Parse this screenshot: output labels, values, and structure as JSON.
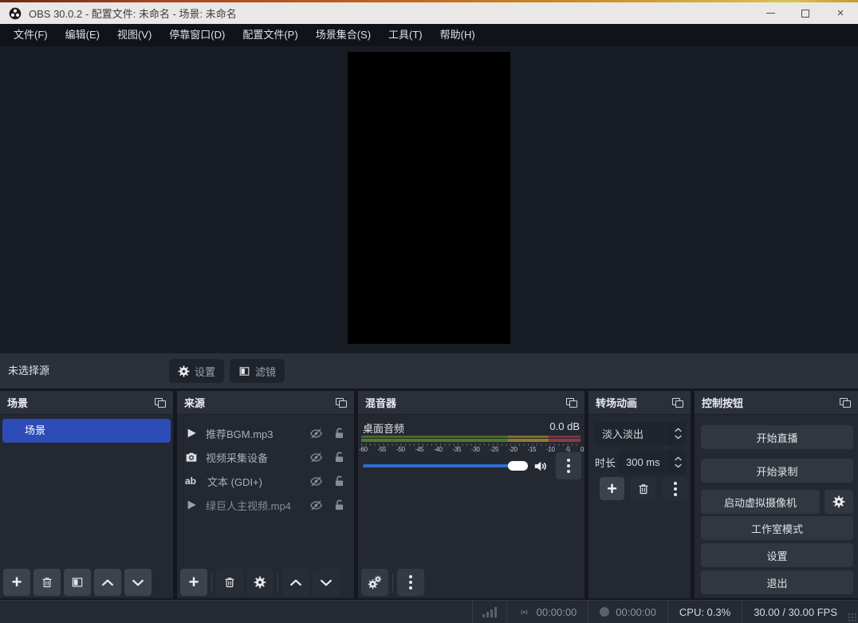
{
  "titlebar": {
    "title": "OBS 30.0.2 - 配置文件: 未命名 - 场景: 未命名"
  },
  "menubar": {
    "items": [
      "文件(F)",
      "编辑(E)",
      "视图(V)",
      "停靠窗口(D)",
      "配置文件(P)",
      "场景集合(S)",
      "工具(T)",
      "帮助(H)"
    ]
  },
  "selection_bar": {
    "status": "未选择源",
    "settings_label": "设置",
    "filters_label": "滤镜"
  },
  "scenes": {
    "title": "场景",
    "items": [
      {
        "label": "场景",
        "selected": true
      }
    ]
  },
  "sources": {
    "title": "来源",
    "items": [
      {
        "icon": "media-play",
        "label": "推荐BGM.mp3",
        "hidden": true,
        "locked": false
      },
      {
        "icon": "camera",
        "label": "视频采集设备",
        "hidden": true,
        "locked": false
      },
      {
        "icon": "text",
        "icon_label": "ab",
        "label": "文本 (GDI+)",
        "hidden": true,
        "locked": false
      },
      {
        "icon": "media-play",
        "label": "绿巨人主视频.mp4",
        "hidden": true,
        "locked": false
      }
    ]
  },
  "mixer": {
    "title": "混音器",
    "channel_name": "桌面音频",
    "level_db": "0.0 dB",
    "scale_labels": [
      "-60",
      "-55",
      "-50",
      "-45",
      "-40",
      "-35",
      "-30",
      "-25",
      "-20",
      "-15",
      "-10",
      "-5",
      "0"
    ],
    "meter": {
      "green_end_db": -20,
      "yellow_end_db": -9,
      "colors": {
        "green": "#4e7a2b",
        "yellow": "#8b7d2a",
        "red": "#8e3a44"
      }
    },
    "slider_color": "#2f6cd4"
  },
  "transitions": {
    "title": "转场动画",
    "selected_transition": "淡入淡出",
    "duration_label": "时长",
    "duration_value": "300 ms"
  },
  "controls": {
    "title": "控制按钮",
    "buttons": [
      "开始直播",
      "开始录制",
      "启动虚拟摄像机",
      "工作室模式",
      "设置",
      "退出"
    ]
  },
  "statusbar": {
    "stream_time": "00:00:00",
    "record_time": "00:00:00",
    "cpu": "CPU: 0.3%",
    "fps": "30.00 / 30.00 FPS"
  },
  "colors": {
    "accent_selected": "#2e4cb5",
    "dock_bg": "#242831",
    "header_bg": "#2a2f39",
    "titlebar_bg": "#eae8e7"
  }
}
